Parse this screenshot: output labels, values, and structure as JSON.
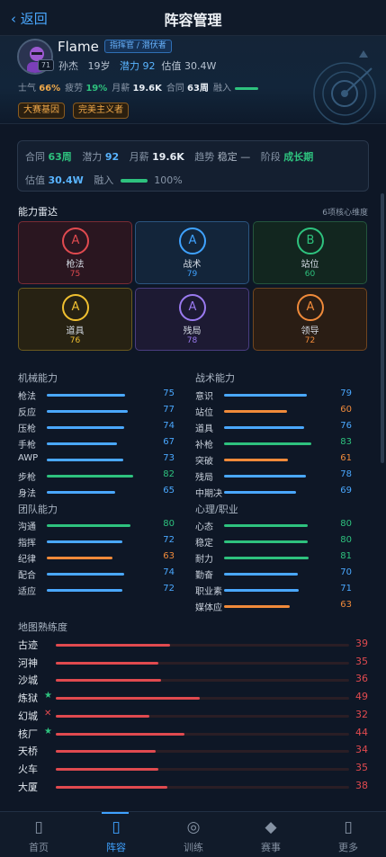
{
  "header": {
    "back_label": "‹ 返回",
    "title": "阵容管理"
  },
  "player": {
    "name": "Flame",
    "role": "指挥官 / 潜伏者",
    "number": "71",
    "real_name": "孙杰",
    "age": "19岁",
    "potential_label": "潜力",
    "potential": "92",
    "valuation_label": "估值",
    "valuation": "30.4W",
    "stats": [
      {
        "label": "士气",
        "value": "66%",
        "color": "#f0a94a"
      },
      {
        "label": "疲劳",
        "value": "19%",
        "color": "#2ec27e"
      },
      {
        "label": "月薪",
        "value": "19.6K",
        "color": "#e7edf4"
      },
      {
        "label": "合同",
        "value": "63周",
        "color": "#e7edf4"
      }
    ],
    "fuse_label": "融入",
    "fuse_level": 1.0,
    "tags": [
      "大赛基因",
      "完美主义者"
    ]
  },
  "contract": {
    "contract_label": "合同",
    "contract_value": "63周",
    "potential_label": "潜力",
    "potential_value": "92",
    "salary_label": "月薪",
    "salary_value": "19.6K",
    "trend_label": "趋势",
    "trend_value": "稳定 —",
    "stage_label": "阶段",
    "stage_value": "成长期",
    "valuation_label": "估值",
    "valuation_value": "30.4W",
    "fuse_label": "融入",
    "fuse_value": "100%",
    "fuse_level": 1.0
  },
  "radar": {
    "title": "能力雷达",
    "subtitle": "6项核心维度",
    "cards": [
      {
        "grade": "A",
        "label": "枪法",
        "value": "75",
        "color": "#e04a4f",
        "bg": "#2a1620",
        "border": "#7a2b34"
      },
      {
        "grade": "A",
        "label": "战术",
        "value": "79",
        "color": "#3fa2ff",
        "bg": "#13253a",
        "border": "#2b5580"
      },
      {
        "grade": "B",
        "label": "站位",
        "value": "60",
        "color": "#2ec27e",
        "bg": "#12261f",
        "border": "#24553d"
      },
      {
        "grade": "A",
        "label": "道具",
        "value": "76",
        "color": "#f0c030",
        "bg": "#272213",
        "border": "#6b5a1e"
      },
      {
        "grade": "A",
        "label": "残局",
        "value": "78",
        "color": "#9a7af0",
        "bg": "#1d1a33",
        "border": "#4a3d80"
      },
      {
        "grade": "A",
        "label": "领导",
        "value": "72",
        "color": "#f08a3a",
        "bg": "#2a1d14",
        "border": "#70451f"
      }
    ]
  },
  "skills": {
    "mechanical": {
      "title": "机械能力",
      "items": [
        {
          "name": "枪法",
          "value": 75,
          "color": "#4aa8ff"
        },
        {
          "name": "反应",
          "value": 77,
          "color": "#4aa8ff"
        },
        {
          "name": "压枪",
          "value": 74,
          "color": "#4aa8ff"
        },
        {
          "name": "手枪",
          "value": 67,
          "color": "#4aa8ff"
        },
        {
          "name": "AWP",
          "value": 73,
          "color": "#4aa8ff"
        },
        {
          "name": "步枪",
          "value": 82,
          "color": "#2ec27e"
        },
        {
          "name": "身法",
          "value": 65,
          "color": "#4aa8ff"
        }
      ]
    },
    "tactical": {
      "title": "战术能力",
      "items": [
        {
          "name": "意识",
          "value": 79,
          "color": "#4aa8ff"
        },
        {
          "name": "站位",
          "value": 60,
          "color": "#f08a3a"
        },
        {
          "name": "道具",
          "value": 76,
          "color": "#4aa8ff"
        },
        {
          "name": "补枪",
          "value": 83,
          "color": "#2ec27e"
        },
        {
          "name": "突破",
          "value": 61,
          "color": "#f08a3a"
        },
        {
          "name": "残局",
          "value": 78,
          "color": "#4aa8ff"
        },
        {
          "name": "中期决",
          "value": 69,
          "color": "#4aa8ff"
        }
      ]
    },
    "team": {
      "title": "团队能力",
      "items": [
        {
          "name": "沟通",
          "value": 80,
          "color": "#2ec27e"
        },
        {
          "name": "指挥",
          "value": 72,
          "color": "#4aa8ff"
        },
        {
          "name": "纪律",
          "value": 63,
          "color": "#f08a3a"
        },
        {
          "name": "配合",
          "value": 74,
          "color": "#4aa8ff"
        },
        {
          "name": "适应",
          "value": 72,
          "color": "#4aa8ff"
        }
      ]
    },
    "mental": {
      "title": "心理/职业",
      "items": [
        {
          "name": "心态",
          "value": 80,
          "color": "#2ec27e"
        },
        {
          "name": "稳定",
          "value": 80,
          "color": "#2ec27e"
        },
        {
          "name": "耐力",
          "value": 81,
          "color": "#2ec27e"
        },
        {
          "name": "勤奋",
          "value": 70,
          "color": "#4aa8ff"
        },
        {
          "name": "职业素",
          "value": 71,
          "color": "#4aa8ff"
        },
        {
          "name": "媒体应",
          "value": 63,
          "color": "#f08a3a"
        }
      ]
    }
  },
  "maps": {
    "title": "地图熟练度",
    "items": [
      {
        "name": "古迹",
        "value": 39,
        "mark": ""
      },
      {
        "name": "河神",
        "value": 35,
        "mark": ""
      },
      {
        "name": "沙城",
        "value": 36,
        "mark": ""
      },
      {
        "name": "炼狱",
        "value": 49,
        "mark": "★",
        "mark_color": "#2ec27e"
      },
      {
        "name": "幻城",
        "value": 32,
        "mark": "✕",
        "mark_color": "#e04a4f"
      },
      {
        "name": "核厂",
        "value": 44,
        "mark": "★",
        "mark_color": "#2ec27e"
      },
      {
        "name": "天桥",
        "value": 34,
        "mark": ""
      },
      {
        "name": "火车",
        "value": 35,
        "mark": ""
      },
      {
        "name": "大厦",
        "value": 38,
        "mark": ""
      }
    ]
  },
  "nav": {
    "items": [
      {
        "label": "首页",
        "icon": "home-icon",
        "active": false
      },
      {
        "label": "阵容",
        "icon": "roster-icon",
        "active": true
      },
      {
        "label": "训练",
        "icon": "training-icon",
        "active": false
      },
      {
        "label": "赛事",
        "icon": "tournament-icon",
        "active": false
      },
      {
        "label": "更多",
        "icon": "more-icon",
        "active": false
      }
    ]
  }
}
